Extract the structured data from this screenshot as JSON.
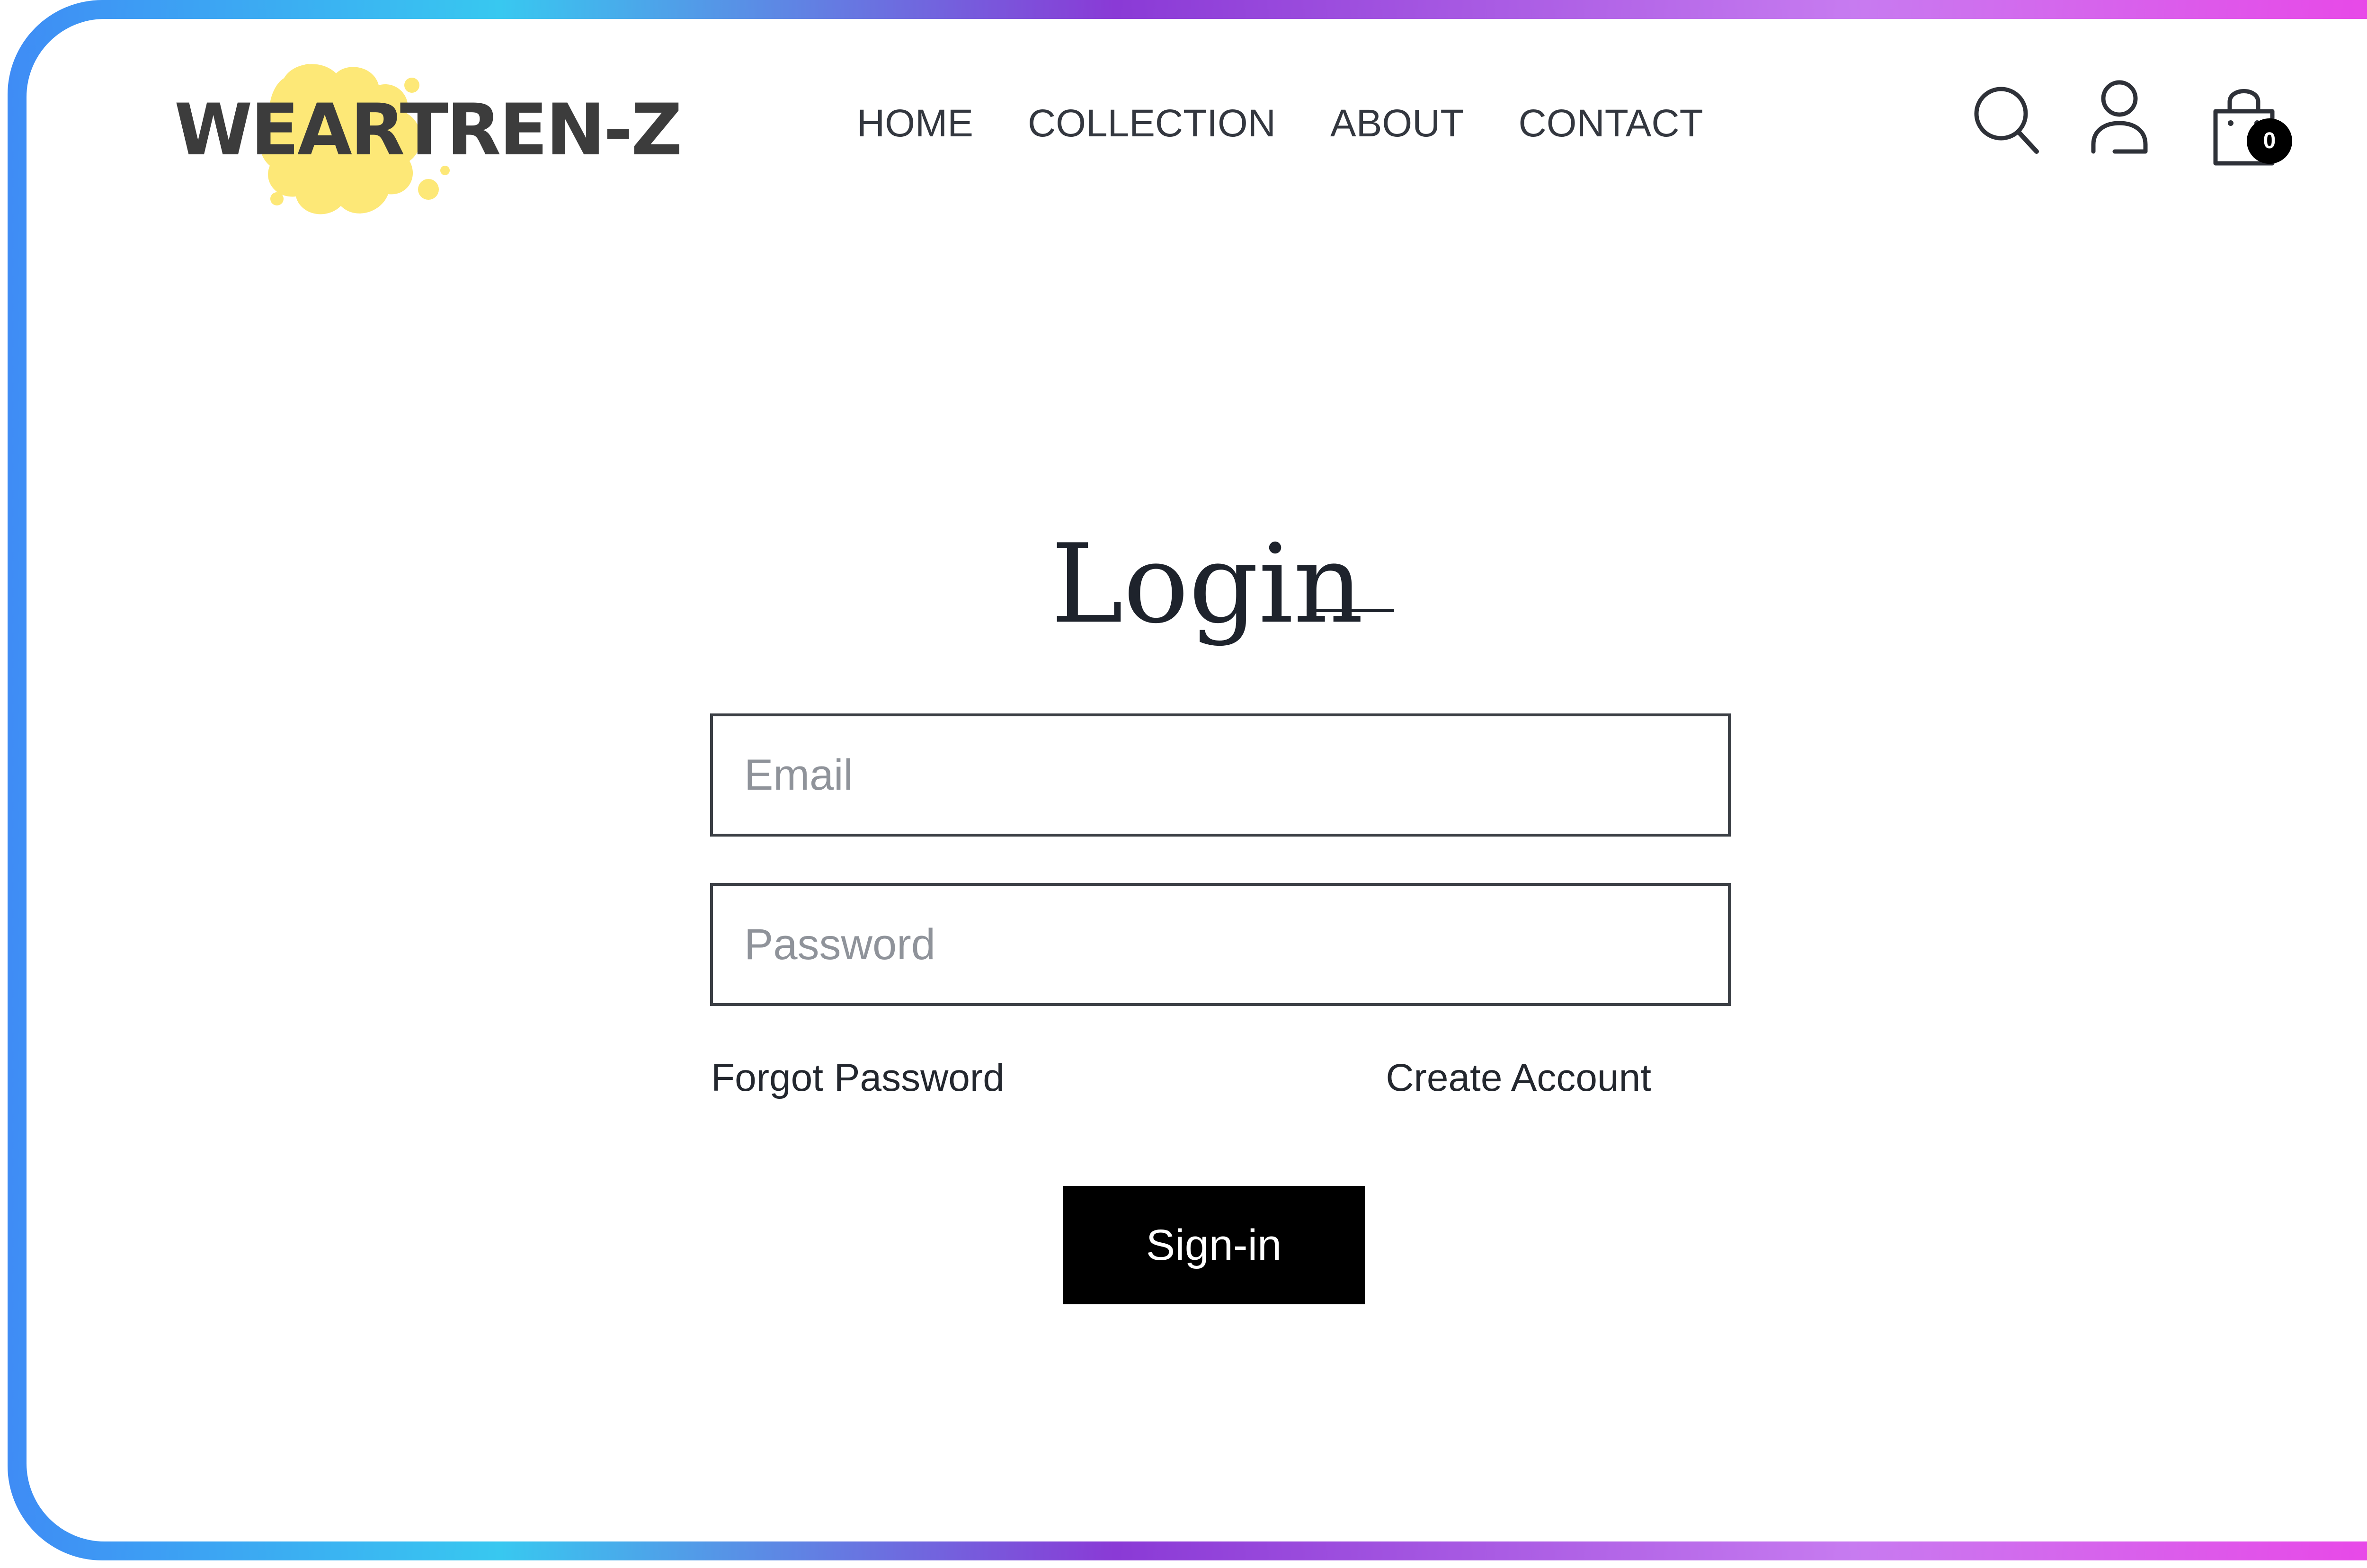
{
  "brand": {
    "logo_text": "WEARTREN-Z",
    "logo_splash_color": "#fde877",
    "text_color": "#3c3c3c"
  },
  "nav": {
    "items": [
      {
        "label": "HOME"
      },
      {
        "label": "COLLECTION"
      },
      {
        "label": "ABOUT"
      },
      {
        "label": "CONTACT"
      }
    ]
  },
  "header_icons": {
    "search": "search-icon",
    "account": "user-icon",
    "cart": "shopping-bag-icon",
    "cart_count": "0"
  },
  "login": {
    "title": "Login",
    "email_placeholder": "Email",
    "password_placeholder": "Password",
    "forgot_password": "Forgot Password",
    "create_account": "Create Account",
    "signin_label": "Sign-in"
  },
  "colors": {
    "button_bg": "#000000",
    "frame_gradient": [
      "#3f8cf5",
      "#38c8f0",
      "#8a3ad6",
      "#c77bf0",
      "#ee3fe6"
    ]
  }
}
